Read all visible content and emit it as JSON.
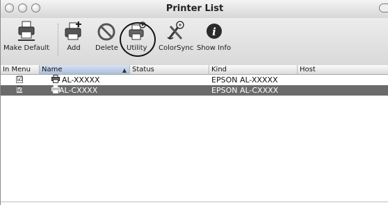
{
  "window": {
    "title": "Printer List"
  },
  "toolbar": {
    "make_default": "Make Default",
    "add": "Add",
    "delete": "Delete",
    "utility": "Utility",
    "colorsync": "ColorSync",
    "show_info": "Show Info"
  },
  "table": {
    "headers": {
      "in_menu": "In Menu",
      "name": "Name",
      "status": "Status",
      "kind": "Kind",
      "host": "Host"
    },
    "sort_indicator": "▲",
    "rows": [
      {
        "in_menu": "☑",
        "name": "AL-XXXXX",
        "status": "",
        "kind": "EPSON AL-XXXXX",
        "host": ""
      },
      {
        "in_menu": "☑",
        "name": "AL-CXXXX",
        "status": "",
        "kind": "EPSON AL-CXXXX",
        "host": ""
      }
    ]
  },
  "colors": {
    "selected_row": "#6b6b6b",
    "sorted_header": "#a9bed9"
  }
}
